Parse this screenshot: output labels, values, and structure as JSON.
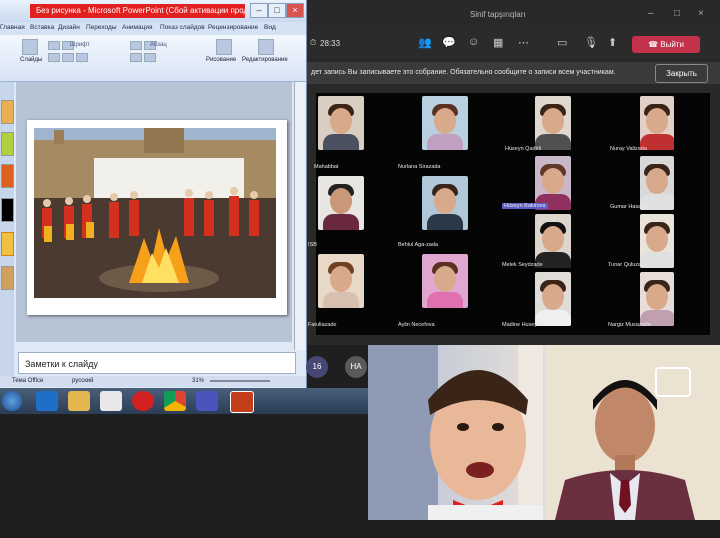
{
  "ppt": {
    "title": "Без рисунка - Microsoft PowerPoint (Сбой активации продукта)",
    "tabs": [
      "Главная",
      "Вставка",
      "Дизайн",
      "Переходы",
      "Анимация",
      "Показ слайдов",
      "Рецензирование",
      "Вид"
    ],
    "groups": {
      "slides": "Слайды",
      "font": "Шрифт",
      "paragraph": "Абзац",
      "drawing": "Рисование",
      "editing": "Редактирование"
    },
    "notes_placeholder": "Заметки к слайду",
    "status": {
      "theme": "Тема Office",
      "language": "русский",
      "zoom": "31%"
    }
  },
  "teams": {
    "window_title": "Sinif tapşırıqları",
    "timer": "28:33",
    "leave_label": "Выйти",
    "recording_banner": "дет запись   Вы записываете это собрание. Обязательно сообщите о записи всем участникам.",
    "recording_close": "Закрыть",
    "participants": [
      {
        "name": "Mahabbat"
      },
      {
        "name": "Nurlana Sirazada"
      },
      {
        "name": "Hüseyn Qadirli"
      },
      {
        "name": "Nuray Valizada"
      },
      {
        "name": "ISB"
      },
      {
        "name": "Behlul Aga-zada"
      },
      {
        "name": "Hüseyn Bakirova"
      },
      {
        "name": "Gumar Hasanli"
      },
      {
        "name": "Melek Seydzade"
      },
      {
        "name": "Tunar Quluzade"
      },
      {
        "name": "Fatullazade"
      },
      {
        "name": "Aylin Necefova"
      },
      {
        "name": "Madine Huseynli"
      },
      {
        "name": "Nargiz Musazade"
      }
    ],
    "overflow_count": "16",
    "initials_avatar": "НА"
  }
}
